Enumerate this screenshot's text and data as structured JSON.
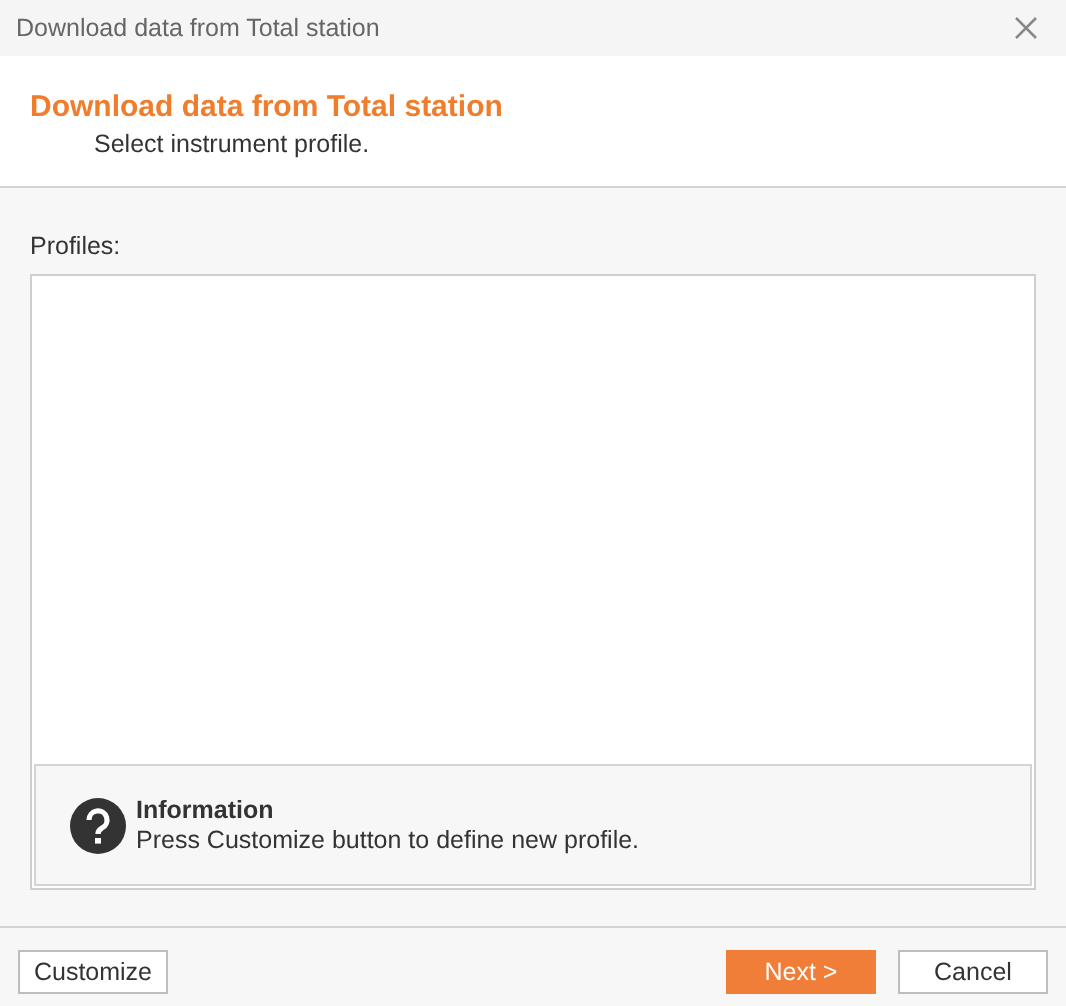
{
  "window": {
    "title": "Download data from Total station"
  },
  "header": {
    "title": "Download data from Total station",
    "subtitle": "Select instrument profile."
  },
  "profiles": {
    "label": "Profiles:"
  },
  "information": {
    "title": "Information",
    "text": "Press Customize button to define new profile."
  },
  "buttons": [
    {
      "label": "Customize",
      "kind": "secondary"
    },
    {
      "label": "Next >",
      "kind": "primary"
    },
    {
      "label": "Cancel",
      "kind": "secondary"
    }
  ]
}
